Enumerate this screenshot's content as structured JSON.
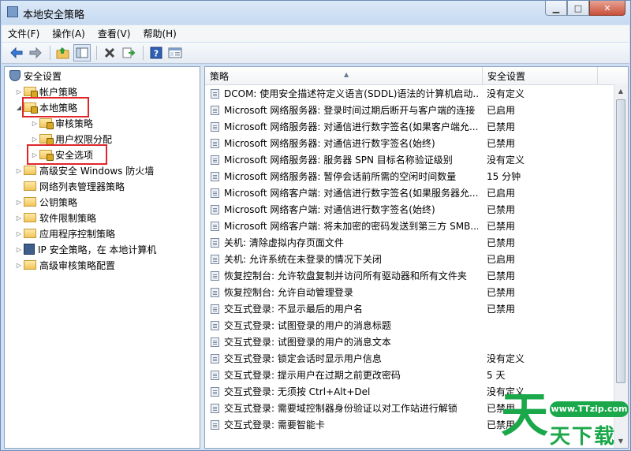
{
  "window": {
    "title": "本地安全策略"
  },
  "menu": [
    "文件(F)",
    "操作(A)",
    "查看(V)",
    "帮助(H)"
  ],
  "toolbar": [
    "back-icon",
    "forward-icon",
    "up-folder-icon",
    "show-hide-tree-icon",
    "delete-icon",
    "export-icon",
    "help-icon",
    "properties-icon"
  ],
  "tree": {
    "root": "安全设置",
    "items": [
      {
        "label": "帐户策略"
      },
      {
        "label": "本地策略"
      },
      {
        "label": "审核策略"
      },
      {
        "label": "用户权限分配"
      },
      {
        "label": "安全选项"
      },
      {
        "label": "高级安全 Windows 防火墙"
      },
      {
        "label": "网络列表管理器策略"
      },
      {
        "label": "公钥策略"
      },
      {
        "label": "软件限制策略"
      },
      {
        "label": "应用程序控制策略"
      },
      {
        "label": "IP 安全策略，在 本地计算机"
      },
      {
        "label": "高级审核策略配置"
      }
    ]
  },
  "list": {
    "headers": {
      "policy": "策略",
      "setting": "安全设置"
    },
    "rows": [
      {
        "policy": "DCOM: 使用安全描述符定义语言(SDDL)语法的计算机启动...",
        "setting": "没有定义"
      },
      {
        "policy": "Microsoft 网络服务器: 登录时间过期后断开与客户端的连接",
        "setting": "已启用"
      },
      {
        "policy": "Microsoft 网络服务器: 对通信进行数字签名(如果客户端允...",
        "setting": "已禁用"
      },
      {
        "policy": "Microsoft 网络服务器: 对通信进行数字签名(始终)",
        "setting": "已禁用"
      },
      {
        "policy": "Microsoft 网络服务器: 服务器 SPN 目标名称验证级别",
        "setting": "没有定义"
      },
      {
        "policy": "Microsoft 网络服务器: 暂停会话前所需的空闲时间数量",
        "setting": "15 分钟"
      },
      {
        "policy": "Microsoft 网络客户端: 对通信进行数字签名(如果服务器允...",
        "setting": "已启用"
      },
      {
        "policy": "Microsoft 网络客户端: 对通信进行数字签名(始终)",
        "setting": "已禁用"
      },
      {
        "policy": "Microsoft 网络客户端: 将未加密的密码发送到第三方 SMB...",
        "setting": "已禁用"
      },
      {
        "policy": "关机: 清除虚拟内存页面文件",
        "setting": "已禁用"
      },
      {
        "policy": "关机: 允许系统在未登录的情况下关闭",
        "setting": "已启用"
      },
      {
        "policy": "恢复控制台: 允许软盘复制并访问所有驱动器和所有文件夹",
        "setting": "已禁用"
      },
      {
        "policy": "恢复控制台: 允许自动管理登录",
        "setting": "已禁用"
      },
      {
        "policy": "交互式登录: 不显示最后的用户名",
        "setting": "已禁用"
      },
      {
        "policy": "交互式登录: 试图登录的用户的消息标题",
        "setting": ""
      },
      {
        "policy": "交互式登录: 试图登录的用户的消息文本",
        "setting": ""
      },
      {
        "policy": "交互式登录: 锁定会话时显示用户信息",
        "setting": "没有定义"
      },
      {
        "policy": "交互式登录: 提示用户在过期之前更改密码",
        "setting": "5 天"
      },
      {
        "policy": "交互式登录: 无须按 Ctrl+Alt+Del",
        "setting": "没有定义"
      },
      {
        "policy": "交互式登录: 需要域控制器身份验证以对工作站进行解锁",
        "setting": "已禁用"
      },
      {
        "policy": "交互式登录: 需要智能卡",
        "setting": "已禁用"
      }
    ]
  },
  "watermark": {
    "badge": "www.TTzip.com",
    "glyph": "天",
    "text": "天下载"
  }
}
